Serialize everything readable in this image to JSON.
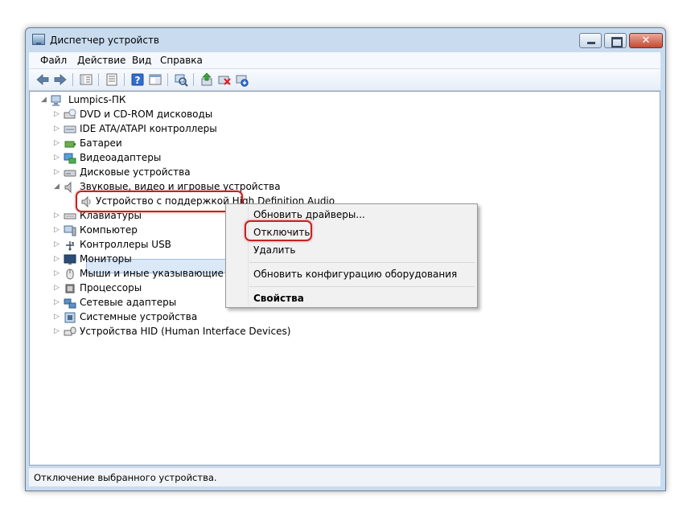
{
  "window": {
    "title": "Диспетчер устройств",
    "close_glyph": "✕"
  },
  "menu": [
    "Файл",
    "Действие",
    "Вид",
    "Справка"
  ],
  "toolbar": {
    "buttons": [
      "back-arrow-icon",
      "forward-arrow-icon",
      "show-hide-tree-icon",
      "properties-icon",
      "help-icon",
      "view-pane-icon",
      "scan-hardware-icon",
      "update-driver-icon",
      "disable-device-icon",
      "uninstall-device-icon"
    ]
  },
  "tree": {
    "root": "Lumpics-ПК",
    "items": [
      {
        "label": "DVD и CD-ROM дисководы",
        "icon": "dvd-drive-icon"
      },
      {
        "label": "IDE ATA/ATAPI контроллеры",
        "icon": "ide-controller-icon"
      },
      {
        "label": "Батареи",
        "icon": "battery-icon"
      },
      {
        "label": "Видеоадаптеры",
        "icon": "display-adapter-icon"
      },
      {
        "label": "Дисковые устройства",
        "icon": "disk-drive-icon"
      },
      {
        "label": "Звуковые, видео и игровые устройства",
        "icon": "speaker-icon",
        "expanded": true
      },
      {
        "label": "Устройство с поддержкой High Definition Audio",
        "icon": "audio-device-icon",
        "child": true,
        "selected": true
      },
      {
        "label": "Клавиатуры",
        "icon": "keyboard-icon"
      },
      {
        "label": "Компьютер",
        "icon": "computer-icon"
      },
      {
        "label": "Контроллеры USB",
        "icon": "usb-controller-icon"
      },
      {
        "label": "Мониторы",
        "icon": "monitor-icon"
      },
      {
        "label": "Мыши и иные указывающие устройства",
        "icon": "mouse-icon"
      },
      {
        "label": "Процессоры",
        "icon": "processor-icon"
      },
      {
        "label": "Сетевые адаптеры",
        "icon": "network-adapter-icon"
      },
      {
        "label": "Системные устройства",
        "icon": "system-device-icon"
      },
      {
        "label": "Устройства HID (Human Interface Devices)",
        "icon": "hid-device-icon"
      }
    ]
  },
  "context_menu": {
    "update": "Обновить драйверы...",
    "disable": "Отключить",
    "uninstall": "Удалить",
    "scan": "Обновить конфигурацию оборудования",
    "properties": "Свойства"
  },
  "status": "Отключение выбранного устройства.",
  "colors": {
    "highlight": "#c42222",
    "selection": "#dbe8f7",
    "window_frame": "#c9dcef"
  }
}
